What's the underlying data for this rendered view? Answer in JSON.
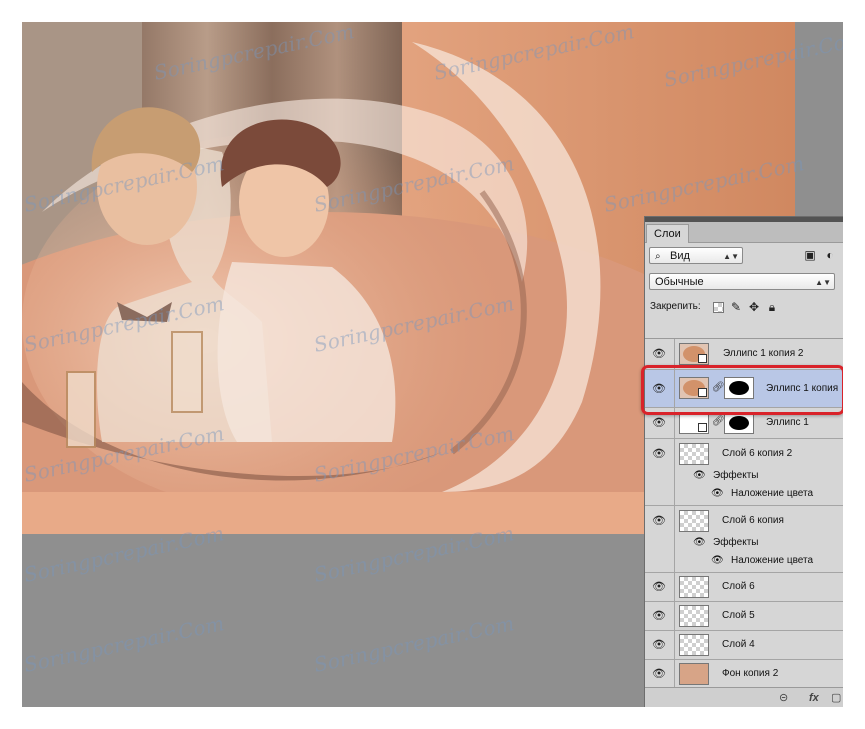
{
  "watermark": "Soringpcrepair.Com",
  "panel": {
    "tab": "Слои",
    "filter": "Вид",
    "blend_mode": "Обычные",
    "lock_label": "Закрепить:"
  },
  "layers": [
    {
      "name": "Эллипс 1 копия 2",
      "type": "shape",
      "fill": "#d2926a",
      "mask": false
    },
    {
      "name": "Эллипс 1 копия",
      "type": "shape",
      "fill": "#d2926a",
      "mask": true,
      "selected": true
    },
    {
      "name": "Эллипс 1",
      "type": "shape",
      "fill": "#ffffff",
      "mask": true
    },
    {
      "name": "Слой 6 копия 2",
      "type": "pixel",
      "effects": "Эффекты",
      "effect": "Наложение цвета"
    },
    {
      "name": "Слой 6 копия",
      "type": "pixel",
      "effects": "Эффекты",
      "effect": "Наложение цвета"
    },
    {
      "name": "Слой 6",
      "type": "pixel"
    },
    {
      "name": "Слой 5",
      "type": "pixel"
    },
    {
      "name": "Слой 4",
      "type": "pixel"
    },
    {
      "name": "Фон копия 2",
      "type": "photo"
    }
  ],
  "colors": {
    "accent": "#d9232a",
    "selected": "#b9c7e6",
    "canvas_main": "#e7a783",
    "workspace": "#8f8f8f"
  },
  "icons": [
    "search-icon",
    "image-filter-icon",
    "adjust-filter-icon",
    "lock-transparent-icon",
    "lock-brush-icon",
    "lock-move-icon",
    "lock-all-icon",
    "eye-icon",
    "link-icon",
    "fx-icon"
  ]
}
